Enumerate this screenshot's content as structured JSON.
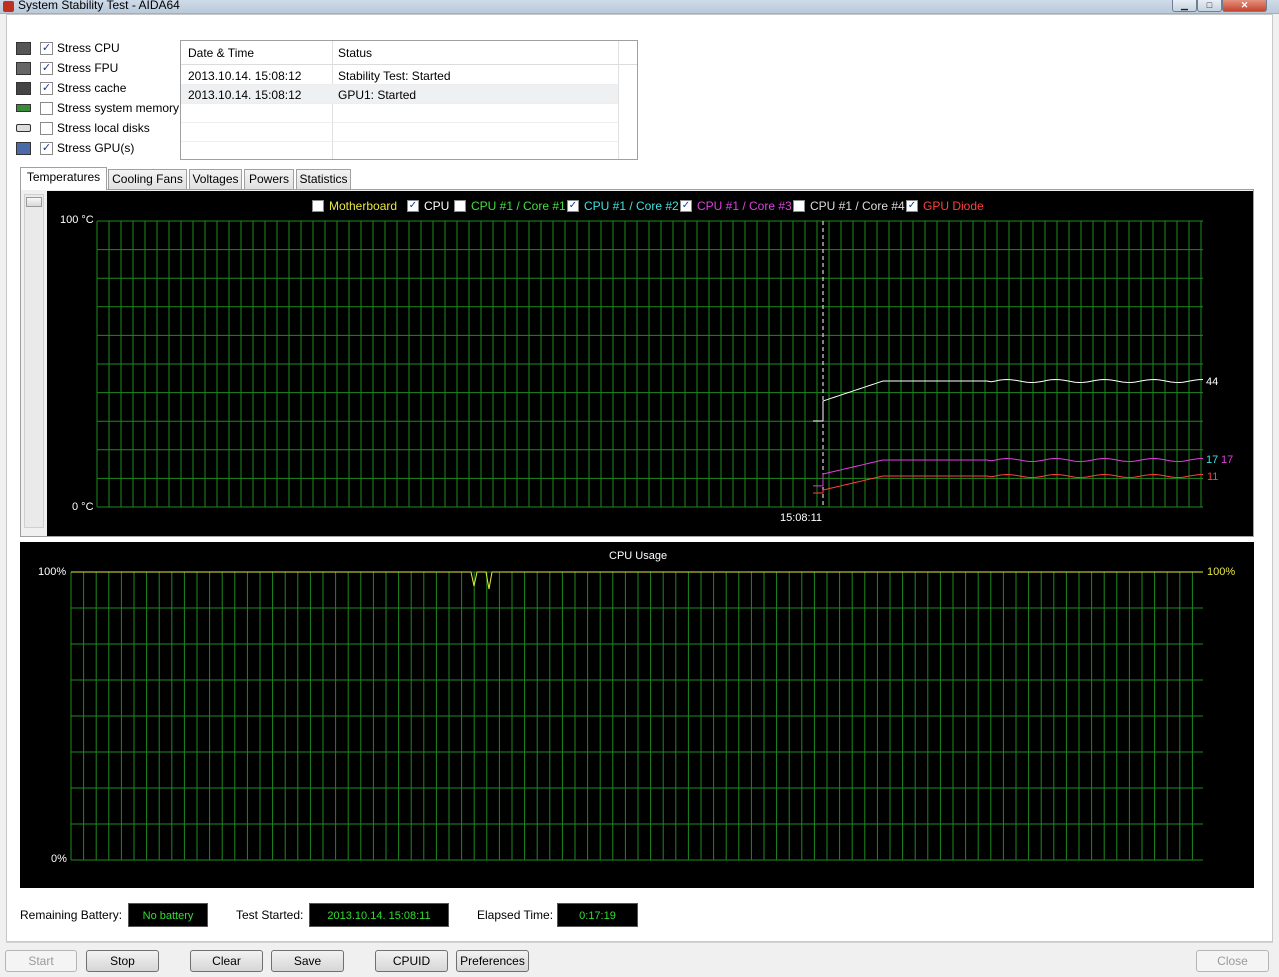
{
  "window": {
    "title": "System Stability Test - AIDA64",
    "buttons": {
      "minimize": "▁",
      "maximize": "□",
      "close": "✕"
    }
  },
  "stress_options": [
    {
      "label": "Stress CPU",
      "checked": true,
      "icon": "cpu-icon"
    },
    {
      "label": "Stress FPU",
      "checked": true,
      "icon": "fpu-icon"
    },
    {
      "label": "Stress cache",
      "checked": true,
      "icon": "cache-icon"
    },
    {
      "label": "Stress system memory",
      "checked": false,
      "icon": "memory-icon"
    },
    {
      "label": "Stress local disks",
      "checked": false,
      "icon": "disk-icon"
    },
    {
      "label": "Stress GPU(s)",
      "checked": true,
      "icon": "gpu-icon"
    }
  ],
  "log": {
    "columns": [
      "Date & Time",
      "Status"
    ],
    "rows": [
      {
        "datetime": "2013.10.14. 15:08:12",
        "status": "Stability Test: Started"
      },
      {
        "datetime": "2013.10.14. 15:08:12",
        "status": "GPU1: Started"
      }
    ]
  },
  "tabs": [
    "Temperatures",
    "Cooling Fans",
    "Voltages",
    "Powers",
    "Statistics"
  ],
  "active_tab": "Temperatures",
  "temp_graph": {
    "legend": [
      {
        "label": "Motherboard",
        "checked": false,
        "color": "#e8e840"
      },
      {
        "label": "CPU",
        "checked": true,
        "color": "#ffffff"
      },
      {
        "label": "CPU #1 / Core #1",
        "checked": false,
        "color": "#40e040"
      },
      {
        "label": "CPU #1 / Core #2",
        "checked": true,
        "color": "#40e0e0"
      },
      {
        "label": "CPU #1 / Core #3",
        "checked": true,
        "color": "#e040e0"
      },
      {
        "label": "CPU #1 / Core #4",
        "checked": false,
        "color": "#dddddd"
      },
      {
        "label": "GPU Diode",
        "checked": true,
        "color": "#ff4040"
      }
    ],
    "y_max_label": "100 °C",
    "y_min_label": "0 °C",
    "marker_time": "15:08:11",
    "values": {
      "cpu": "44",
      "core2": "17",
      "core3": "17",
      "gpu": "11"
    }
  },
  "cpu_graph": {
    "title": "CPU Usage",
    "y_max_label": "100%",
    "y_min_label": "0%",
    "current_value": "100%"
  },
  "status": {
    "battery_label": "Remaining Battery:",
    "battery_value": "No battery",
    "started_label": "Test Started:",
    "started_value": "2013.10.14. 15:08:11",
    "elapsed_label": "Elapsed Time:",
    "elapsed_value": "0:17:19"
  },
  "buttons": {
    "start": "Start",
    "stop": "Stop",
    "clear": "Clear",
    "save": "Save",
    "cpuid": "CPUID",
    "preferences": "Preferences",
    "close": "Close"
  },
  "colors": {
    "grid": "#1e8a1e",
    "graph_bg": "#000000",
    "cpu_line": "#ffffff",
    "core3_line": "#e040e0",
    "gpu_line": "#ff4040",
    "usage_line": "#e8e840",
    "value_text": "#33dd33"
  }
}
